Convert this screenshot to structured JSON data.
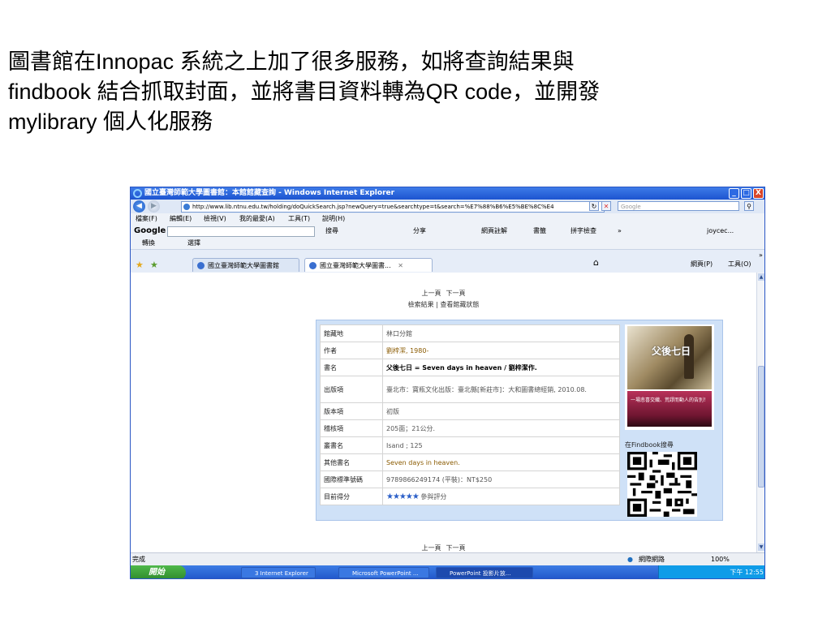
{
  "slide": {
    "lines": [
      "圖書館在Innopac 系統之上加了很多服務，如將查詢結果與",
      "findbook 結合抓取封面，並將書目資料轉為QR code，並開發",
      "mylibrary 個人化服務"
    ]
  },
  "window": {
    "title": "國立臺灣師範大學圖書館：本館館藏查詢 - Windows Internet Explorer",
    "minimize": "_",
    "maximize": "□",
    "close": "X"
  },
  "addressbar": {
    "url": "http://www.lib.ntnu.edu.tw/holding/doQuickSearch.jsp?newQuery=true&searchtype=t&search=%E7%88%B6%E5%BE%8C%E4",
    "search_placeholder": "Google",
    "back": "◀",
    "forward": "▶",
    "refresh": "↻",
    "stop": "✕",
    "search_go": "⚲"
  },
  "menubar": {
    "items": [
      "檔案(F)",
      "編輯(E)",
      "檢視(V)",
      "我的最愛(A)",
      "工具(T)",
      "說明(H)"
    ]
  },
  "googlebar": {
    "logo": "Google",
    "search_label": "搜尋",
    "share_label": "分享",
    "annotate_label": "網頁註解",
    "bookmarks_label": "書籤",
    "spell_label": "拼字檢查",
    "more_label": "»",
    "user": "joycec..."
  },
  "linkbar": {
    "convert": "轉換",
    "select": "選擇"
  },
  "tabs": [
    {
      "label": "國立臺灣師範大學圖書館"
    },
    {
      "label": "國立臺灣師範大學圖書...",
      "close": "✕"
    }
  ],
  "commandbar": {
    "home": "⌂",
    "page": "網頁(P)",
    "tools": "工具(O)",
    "more": "»"
  },
  "pager": {
    "prev": "上一頁",
    "next": "下一頁",
    "results": "檢索結果",
    "sep": "|",
    "holdings": "查看館藏狀態"
  },
  "record": {
    "rows": [
      {
        "label": "館藏地",
        "value": "林口分館"
      },
      {
        "label": "作者",
        "value": "劉梓潔, 1980-"
      },
      {
        "label": "書名",
        "value": "父後七日 = Seven days in heaven / 劉梓潔作."
      },
      {
        "label": "出版項",
        "value": "臺北市：寶瓶文化出版：臺北縣[新莊市]：大和圖書總經銷, 2010.08."
      },
      {
        "label": "版本項",
        "value": "初版"
      },
      {
        "label": "稽核項",
        "value": "205面；21公分."
      },
      {
        "label": "叢書名",
        "value": "Isand ; 125"
      },
      {
        "label": "其他書名",
        "value": "Seven days in heaven."
      },
      {
        "label": "國際標準號碼",
        "value": "9789866249174 (平裝)：NT$250"
      },
      {
        "label": "目前得分",
        "value": "參與評分",
        "stars": "★★★★★"
      }
    ],
    "cover_title": "父後七日",
    "cover_band_text": "一場悲喜交織、荒謬而動人的告別！",
    "findbook_label": "在Findbook搜尋"
  },
  "statusbar": {
    "status": "完成",
    "zone": "網際網路",
    "zoom": "100%"
  },
  "taskbar": {
    "start": "開始",
    "buttons": [
      "3 Internet Explorer",
      "Microsoft PowerPoint ...",
      "PowerPoint 投影片放..."
    ],
    "clock": "下午 12:55"
  },
  "colors": {
    "titlebar": "#1d54d0",
    "record_bg": "#cfe1f7",
    "star": "#2b5fc8"
  }
}
